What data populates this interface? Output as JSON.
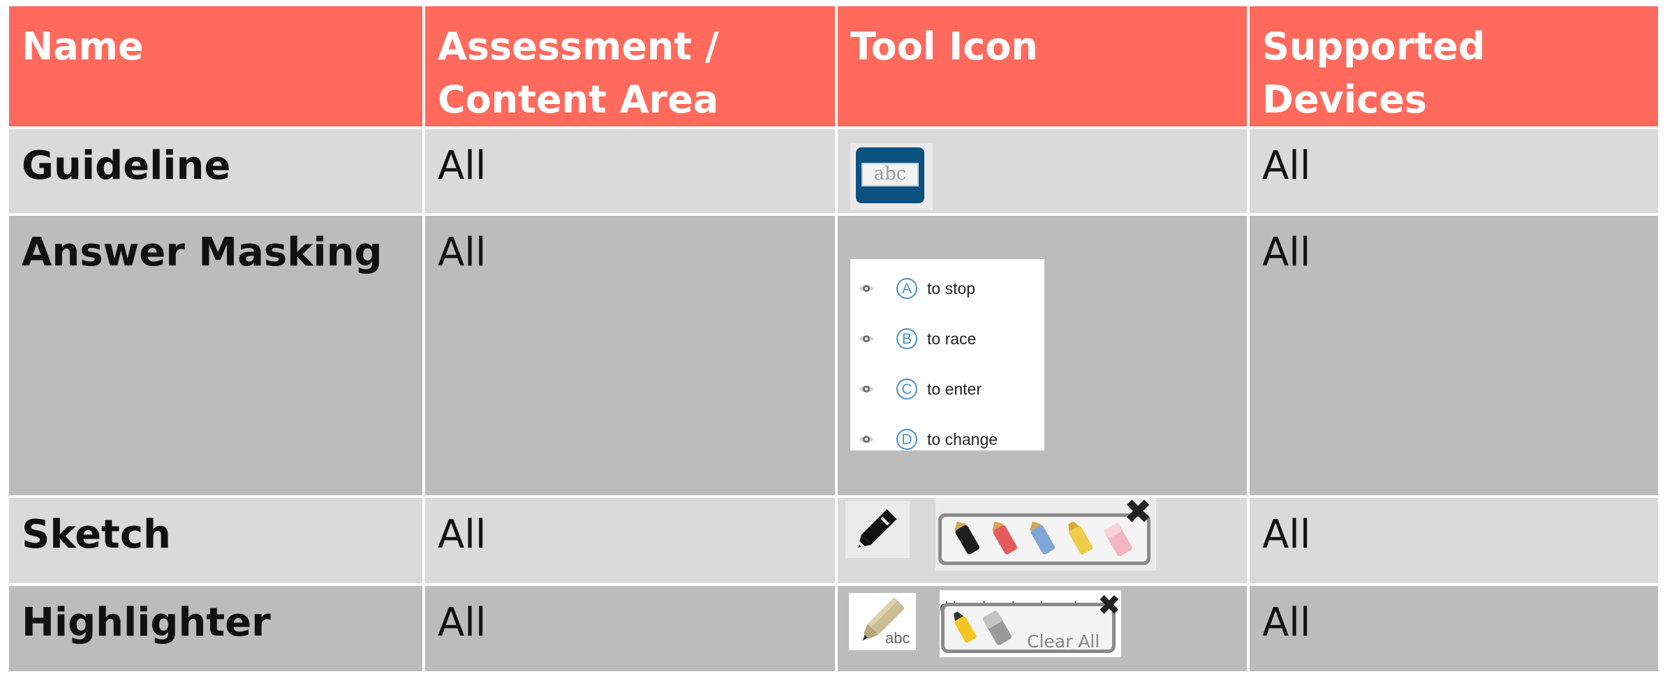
{
  "headers": [
    "Name",
    "Assessment / Content Area",
    "Tool Icon",
    "Supported Devices"
  ],
  "rows": [
    {
      "name": "Guideline",
      "area": "All",
      "devices": "All"
    },
    {
      "name": "Answer Masking",
      "area": "All",
      "devices": "All"
    },
    {
      "name": "Sketch",
      "area": "All",
      "devices": "All"
    },
    {
      "name": "Highlighter",
      "area": "All",
      "devices": "All"
    }
  ],
  "guideline_icon": {
    "text": "abc",
    "color": "#0c5180"
  },
  "answer_masking": {
    "options": [
      {
        "letter": "A",
        "text": "to stop"
      },
      {
        "letter": "B",
        "text": "to race"
      },
      {
        "letter": "C",
        "text": "to enter"
      },
      {
        "letter": "D",
        "text": "to change"
      }
    ],
    "icon": "eye-icon",
    "accent": "#4a90c8"
  },
  "sketch": {
    "tools": [
      "pencil-black",
      "pencil-red",
      "pencil-blue",
      "highlighter-yellow",
      "eraser-pink"
    ]
  },
  "highlighter": {
    "icon_text": "abc",
    "doc_text": "d he also developed",
    "clear_label": "Clear All"
  },
  "colors": {
    "header": "#ff6a5c",
    "row_light": "#dadada",
    "row_dark": "#bcbcbc"
  }
}
